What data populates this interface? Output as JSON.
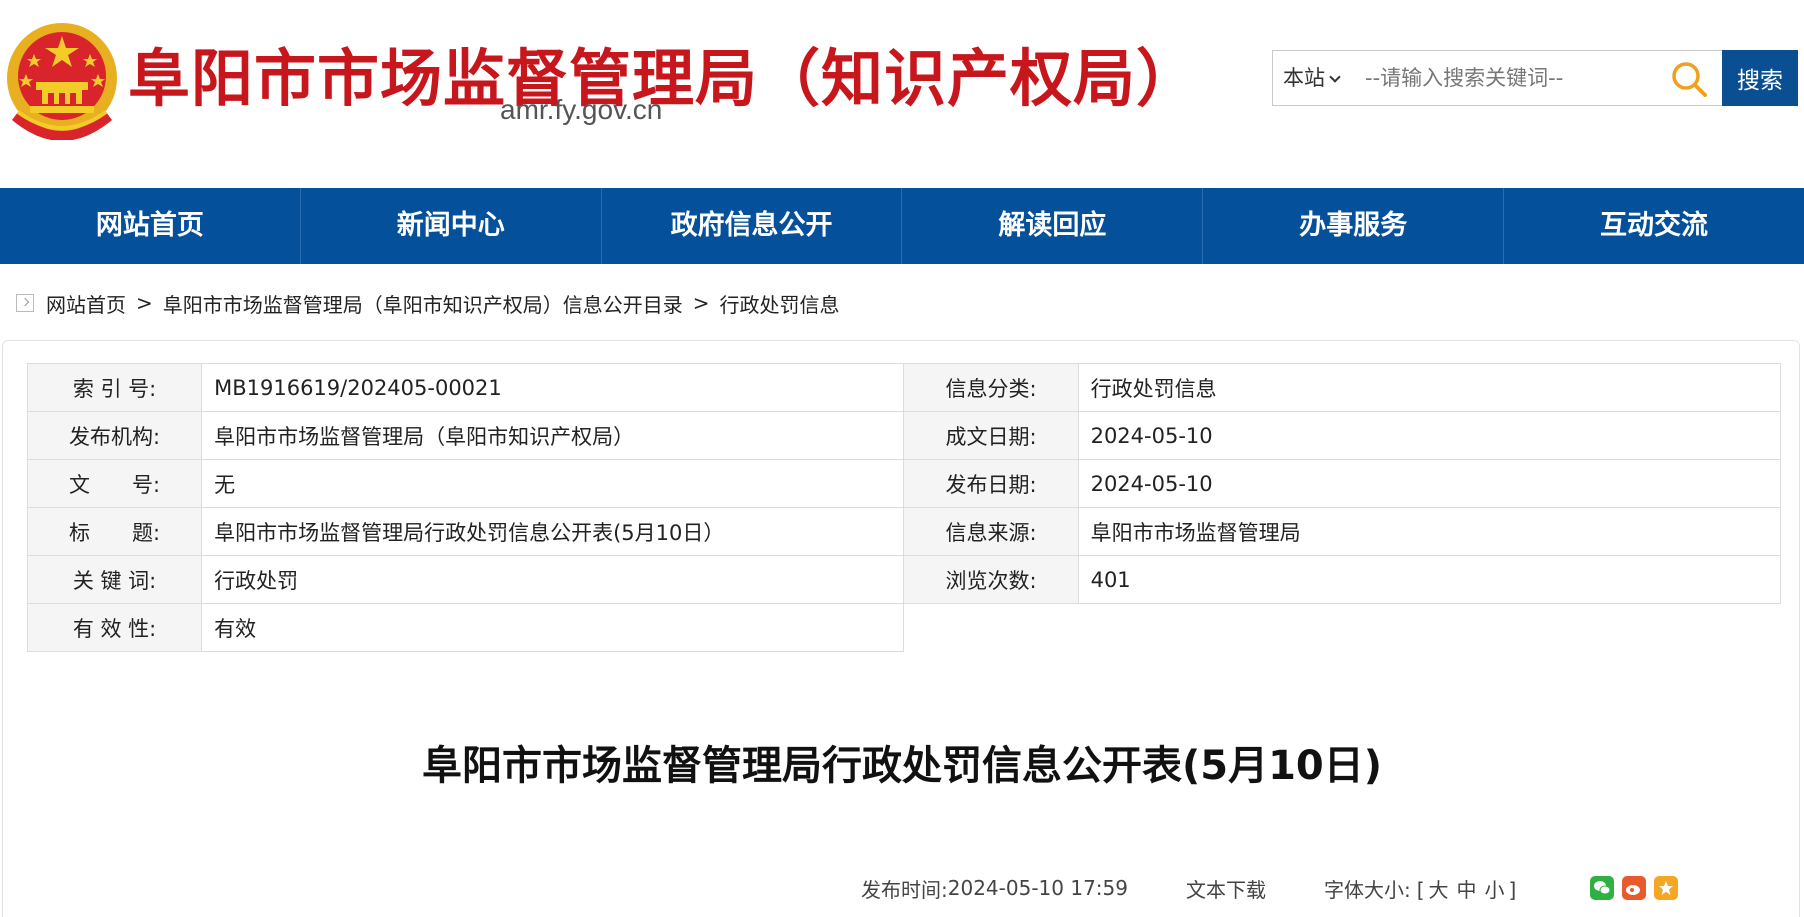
{
  "header": {
    "site_title": "阜阳市市场监督管理局（知识产权局）",
    "domain": "amr.fy.gov.cn",
    "search": {
      "scope": "本站",
      "placeholder": "--请输入搜索关键词--",
      "button": "搜索"
    },
    "colors": {
      "brand_red": "#c8161d",
      "nav_blue": "#05509a"
    }
  },
  "nav": {
    "items": [
      "网站首页",
      "新闻中心",
      "政府信息公开",
      "解读回应",
      "办事服务",
      "互动交流"
    ]
  },
  "breadcrumb": {
    "items": [
      "网站首页",
      "阜阳市市场监督管理局（阜阳市知识产权局）信息公开目录",
      "行政处罚信息"
    ],
    "separator": ">"
  },
  "meta": {
    "index_label": "索 引 号:",
    "index_value": "MB1916619/202405-00021",
    "category_label": "信息分类:",
    "category_value": "行政处罚信息",
    "publisher_label": "发布机构:",
    "publisher_value": "阜阳市市场监督管理局（阜阳市知识产权局）",
    "written_date_label": "成文日期:",
    "written_date_value": "2024-05-10",
    "doc_no_label": "文　　号:",
    "doc_no_value": "无",
    "publish_date_label": "发布日期:",
    "publish_date_value": "2024-05-10",
    "title_label": "标　　题:",
    "title_value": "阜阳市市场监督管理局行政处罚信息公开表(5月10日）",
    "source_label": "信息来源:",
    "source_value": "阜阳市市场监督管理局",
    "keywords_label": "关 键 词:",
    "keywords_value": "行政处罚",
    "views_label": "浏览次数:",
    "views_value": "401",
    "validity_label": "有 效 性:",
    "validity_value": "有效"
  },
  "article": {
    "title": "阜阳市市场监督管理局行政处罚信息公开表(5月10日)",
    "publish_time_label": "发布时间:",
    "publish_time": "2024-05-10 17:59",
    "download": "文本下载",
    "font_size_label": "字体大小:",
    "font_size_open": "[",
    "font_large": "大",
    "font_medium": "中",
    "font_small": "小",
    "font_size_close": "]",
    "share_icons": [
      "wechat-icon",
      "weibo-icon",
      "favorite-icon"
    ]
  }
}
